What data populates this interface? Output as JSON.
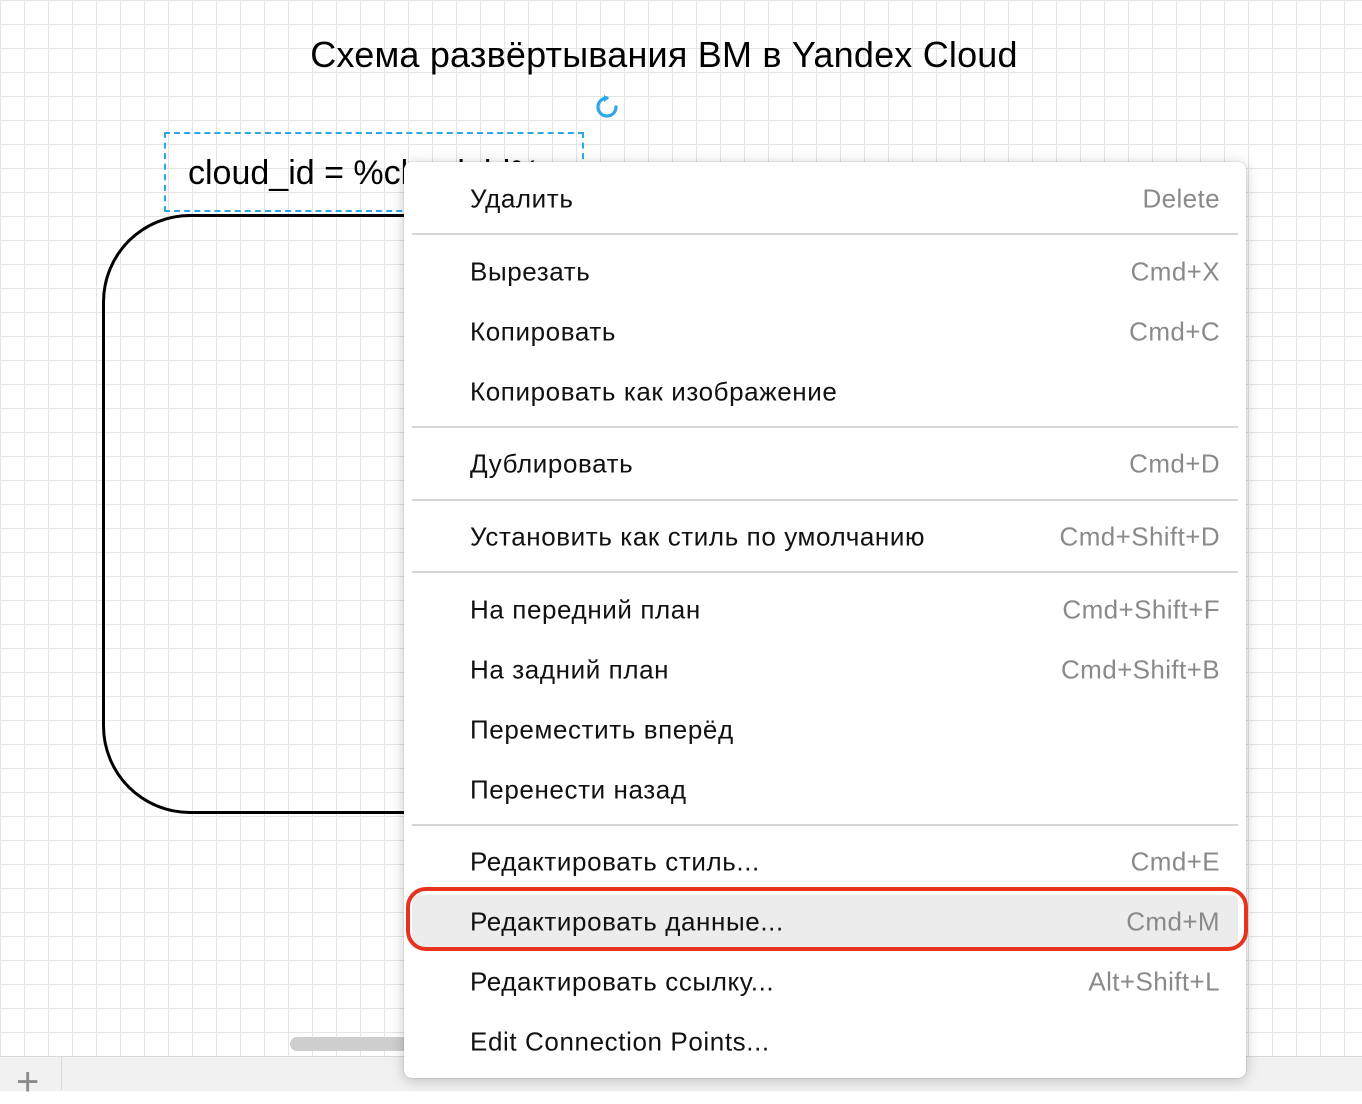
{
  "diagram": {
    "title": "Схема развёртывания ВМ в Yandex Cloud",
    "selected_label": "cloud_id = %cloud_id%"
  },
  "context_menu": {
    "items": [
      {
        "label": "Удалить",
        "shortcut": "Delete"
      },
      {
        "label": "Вырезать",
        "shortcut": "Cmd+X"
      },
      {
        "label": "Копировать",
        "shortcut": "Cmd+C"
      },
      {
        "label": "Копировать как изображение",
        "shortcut": ""
      },
      {
        "label": "Дублировать",
        "shortcut": "Cmd+D"
      },
      {
        "label": "Установить как стиль по умолчанию",
        "shortcut": "Cmd+Shift+D"
      },
      {
        "label": "На передний план",
        "shortcut": "Cmd+Shift+F"
      },
      {
        "label": "На задний план",
        "shortcut": "Cmd+Shift+B"
      },
      {
        "label": "Переместить вперёд",
        "shortcut": ""
      },
      {
        "label": "Перенести назад",
        "shortcut": ""
      },
      {
        "label": "Редактировать стиль...",
        "shortcut": "Cmd+E"
      },
      {
        "label": "Редактировать данные...",
        "shortcut": "Cmd+M"
      },
      {
        "label": "Редактировать ссылку...",
        "shortcut": "Alt+Shift+L"
      },
      {
        "label": "Edit Connection Points...",
        "shortcut": ""
      }
    ]
  },
  "bottom_bar": {
    "add_page_label": "+"
  },
  "colors": {
    "selection": "#2ea7e6",
    "highlight": "#e8331c",
    "hover": "#ececec"
  },
  "icons": {
    "rotate": "rotate-icon"
  }
}
